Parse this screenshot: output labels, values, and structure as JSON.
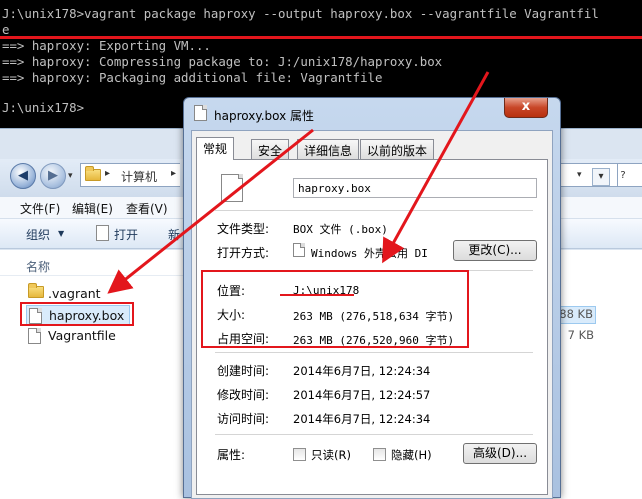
{
  "terminal": {
    "lines": [
      "J:\\unix178>vagrant package haproxy --output haproxy.box --vagrantfile Vagrantfil",
      "e",
      "==> haproxy: Exporting VM...",
      "==> haproxy: Compressing package to: J:/unix178/haproxy.box",
      "==> haproxy: Packaging additional file: Vagrantfile",
      "",
      "J:\\unix178>"
    ]
  },
  "explorer": {
    "breadcrumb": "计算机",
    "menu": [
      "文件(F)",
      "编辑(E)",
      "查看(V)"
    ],
    "toolbar": {
      "organize": "组织",
      "open": "打开",
      "new": "新"
    },
    "column_name": "名称",
    "files": [
      {
        "name": ".vagrant",
        "type": "folder"
      },
      {
        "name": "haproxy.box",
        "type": "file",
        "selected": true
      },
      {
        "name": "Vagrantfile",
        "type": "file"
      }
    ],
    "sizes": [
      "88 KB",
      "7 KB"
    ]
  },
  "dialog": {
    "title": "haproxy.box 属性",
    "close": "x",
    "tabs": [
      "常规",
      "安全",
      "详细信息",
      "以前的版本"
    ],
    "file_name": "haproxy.box",
    "labels": {
      "file_type": "文件类型:",
      "open_with": "打开方式:",
      "location": "位置:",
      "size": "大小:",
      "size_on_disk": "占用空间:",
      "created": "创建时间:",
      "modified": "修改时间:",
      "accessed": "访问时间:",
      "attributes": "属性:"
    },
    "values": {
      "file_type": "BOX 文件 (.box)",
      "open_with": "Windows 外壳公用 DI",
      "location": "J:\\unix178",
      "size": "263 MB (276,518,634 字节)",
      "size_on_disk": "263 MB (276,520,960 字节)",
      "created": "2014年6月7日, 12:24:34",
      "modified": "2014年6月7日, 12:24:57",
      "accessed": "2014年6月7日, 12:24:34"
    },
    "buttons": {
      "change": "更改(C)...",
      "advanced": "高级(D)..."
    },
    "checkboxes": {
      "readonly": "只读(R)",
      "hidden": "隐藏(H)"
    }
  },
  "colors": {
    "annotation": "#e3161c",
    "terminal_text": "#c0c0c0"
  }
}
